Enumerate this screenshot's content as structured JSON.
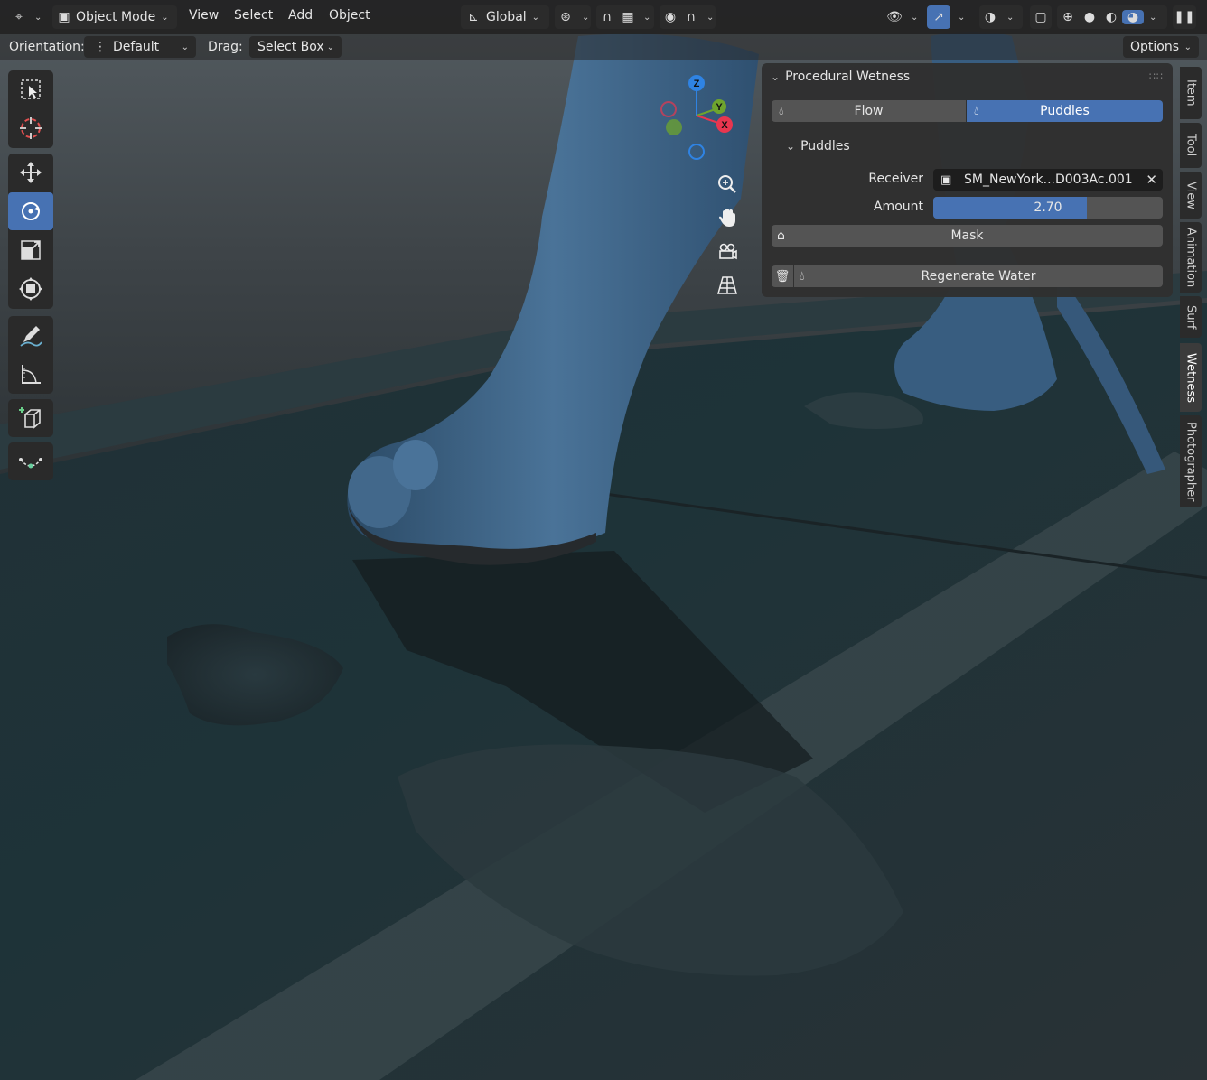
{
  "header": {
    "mode_label": "Object Mode",
    "menus": [
      "View",
      "Select",
      "Add",
      "Object"
    ],
    "transform_orientation": "Global"
  },
  "tool_settings": {
    "orientation_label": "Orientation:",
    "orientation_value": "Default",
    "drag_label": "Drag:",
    "drag_value": "Select Box",
    "options_label": "Options"
  },
  "gizmo": {
    "axes": [
      "Z",
      "Y",
      "X"
    ],
    "colors": {
      "x": "#e8364f",
      "y": "#6ea42d",
      "z": "#2f83e3"
    }
  },
  "panel": {
    "title": "Procedural Wetness",
    "tabs": [
      "Flow",
      "Puddles"
    ],
    "active_tab": "Puddles",
    "subpanel_title": "Puddles",
    "receiver_label": "Receiver",
    "receiver_value": "SM_NewYork...D003Ac.001",
    "amount_label": "Amount",
    "amount_value": "2.70",
    "amount_fill": 0.67,
    "mask_label": "Mask",
    "regenerate_label": "Regenerate Water"
  },
  "sidebar_tabs": [
    "Item",
    "Tool",
    "View",
    "Animation",
    "Surf",
    "Wetness",
    "Photographer"
  ],
  "active_sidebar_tab": "Wetness",
  "colors": {
    "accent": "#4772b3",
    "header_bg": "#222222",
    "panel_bg": "#303030"
  }
}
